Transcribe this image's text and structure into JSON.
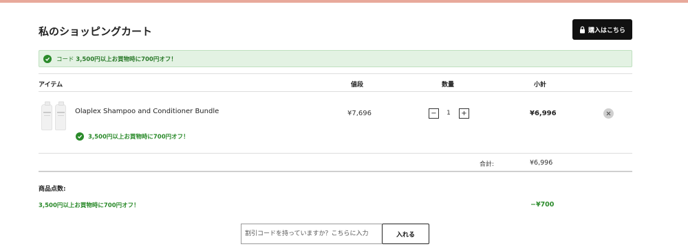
{
  "colors": {
    "top_bar": "#e8a99b",
    "promo_green": "#2a8a2a",
    "banner_bg": "#e3f2e3",
    "checkout_bg": "#111111"
  },
  "header": {
    "title": "私のショッピングカート",
    "checkout_label": "購入はこちら",
    "checkout_icon": "lock-icon"
  },
  "promo_banner": {
    "icon": "check-circle-icon",
    "prefix": "コード",
    "text": "3,500円以上お買物時に700円オフ！"
  },
  "table": {
    "headers": {
      "item": "アイテム",
      "price": "値段",
      "quantity": "数量",
      "subtotal": "小計"
    },
    "rows": [
      {
        "name": "Olaplex Shampoo and Conditioner Bundle",
        "price": "¥7,696",
        "quantity": "1",
        "quantity_minus": "−",
        "quantity_plus": "+",
        "subtotal": "¥6,996",
        "promo": "3,500円以上お買物時に700円オフ！",
        "remove_icon": "close-icon"
      }
    ]
  },
  "totals": {
    "total_label": "合計:",
    "total_value": "¥6,996"
  },
  "summary": {
    "items_count_label": "商品点数:",
    "discount_label": "3,500円以上お買物時に700円オフ！",
    "discount_value": "−¥700"
  },
  "coupon": {
    "placeholder": "割引コードを持っていますか？こちらに入力",
    "apply_label": "入れる"
  }
}
